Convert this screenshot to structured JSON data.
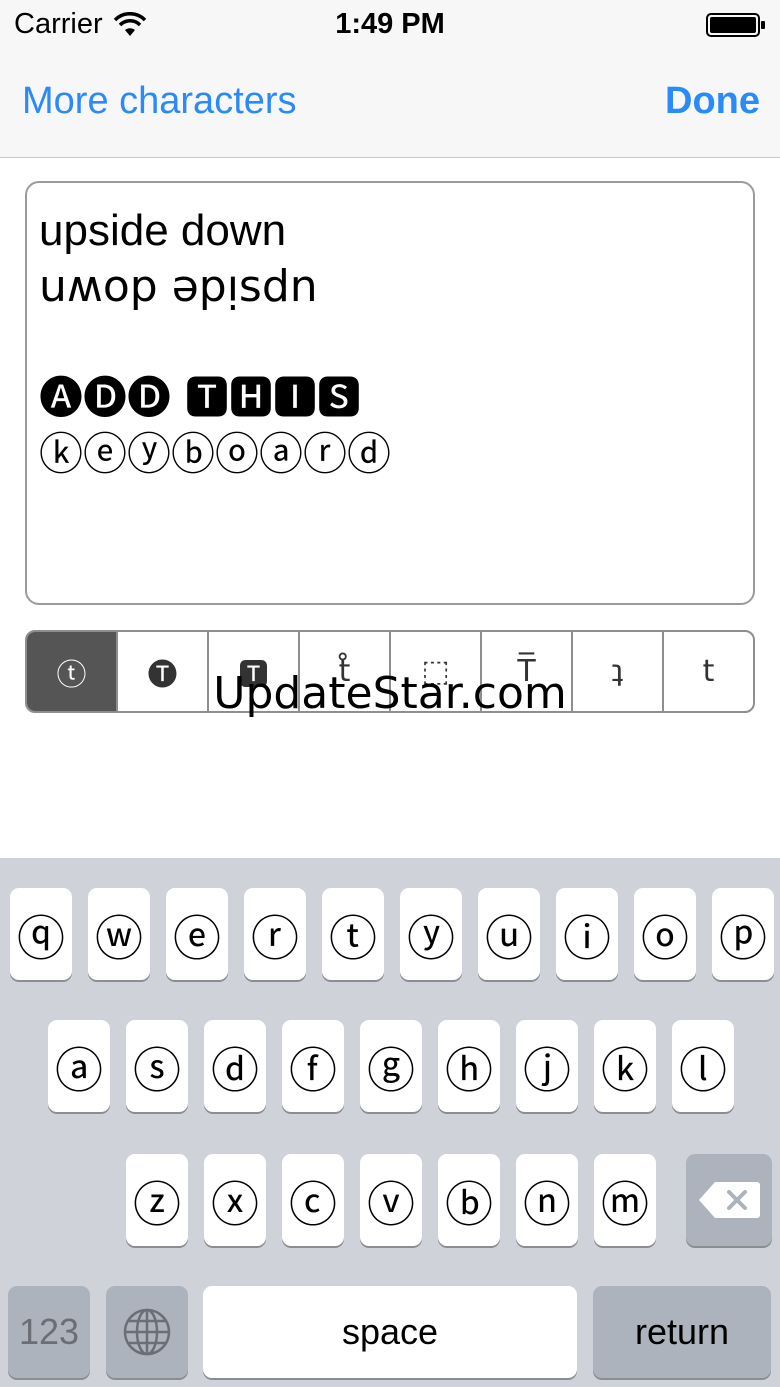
{
  "status_bar": {
    "carrier": "Carrier",
    "time": "1:49 PM"
  },
  "nav": {
    "left_label": "More characters",
    "right_label": "Done",
    "accent_color": "#2a8af6"
  },
  "text_area": {
    "lines": [
      "upside down",
      "uʍop ǝpᴉsdn",
      "",
      "🅐🅓🅓 🆃🅷🅸🆂",
      "ⓚⓔⓨⓑⓞⓐⓡⓓ"
    ]
  },
  "style_selector": {
    "segments": [
      {
        "label": "ⓣ",
        "active": true
      },
      {
        "label": "🅣",
        "active": false
      },
      {
        "label": "🆃",
        "active": false
      },
      {
        "label": "t̊",
        "active": false
      },
      {
        "label": "⬚",
        "active": false
      },
      {
        "label": "T̅",
        "active": false
      },
      {
        "label": "ʇ",
        "active": false
      },
      {
        "label": "t",
        "active": false
      }
    ]
  },
  "watermark": "UpdateStar.com",
  "keyboard": {
    "row1": [
      "ⓠ",
      "ⓦ",
      "ⓔ",
      "ⓡ",
      "ⓣ",
      "ⓨ",
      "ⓤ",
      "ⓘ",
      "ⓞ",
      "ⓟ"
    ],
    "row2": [
      "ⓐ",
      "ⓢ",
      "ⓓ",
      "ⓕ",
      "ⓖ",
      "ⓗ",
      "ⓙ",
      "ⓚ",
      "ⓛ"
    ],
    "row3": [
      "ⓩ",
      "ⓧ",
      "ⓒ",
      "ⓥ",
      "ⓑ",
      "ⓝ",
      "ⓜ"
    ],
    "numbers_label": "123",
    "space_label": "space",
    "return_label": "return"
  }
}
